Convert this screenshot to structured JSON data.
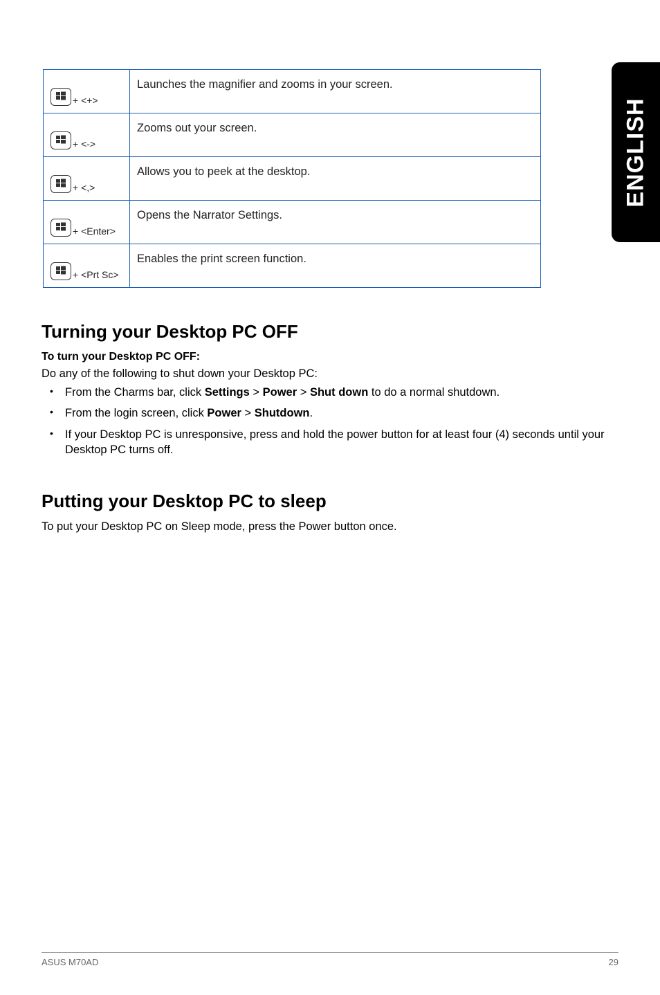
{
  "sideTab": "ENGLISH",
  "table": {
    "rows": [
      {
        "key": "+ <+>",
        "desc": "Launches the magnifier and zooms in your screen."
      },
      {
        "key": "+ <->",
        "desc": "Zooms out your screen."
      },
      {
        "key": "+ <,>",
        "desc": "Allows you to peek at the desktop."
      },
      {
        "key": "+ <Enter>",
        "desc": "Opens the Narrator Settings."
      },
      {
        "key": "+ <Prt Sc>",
        "desc": "Enables the print screen function."
      }
    ]
  },
  "section1": {
    "h_plain": "Turning your ",
    "h_bold": "Desktop PC OFF",
    "sub": "To turn your Desktop PC OFF:",
    "intro": "Do any of the following to shut down your Desktop PC:",
    "bullets": [
      {
        "pre": "From the Charms bar, click ",
        "b1": "Settings",
        "mid1": " > ",
        "b2": "Power",
        "mid2": " > ",
        "b3": "Shut down",
        "post": " to do a normal shutdown."
      },
      {
        "pre": "From the login screen, click ",
        "b1": "Power",
        "mid1": " > ",
        "b2": "Shutdown",
        "post": "."
      },
      {
        "plain": "If your Desktop PC is unresponsive, press and hold the power  button for at least four (4) seconds until your Desktop PC turns off."
      }
    ]
  },
  "section2": {
    "h": "Putting your Desktop PC to sleep",
    "body": "To put your Desktop PC on Sleep mode, press the Power button once."
  },
  "footer": {
    "left": "ASUS M70AD",
    "right": "29"
  }
}
